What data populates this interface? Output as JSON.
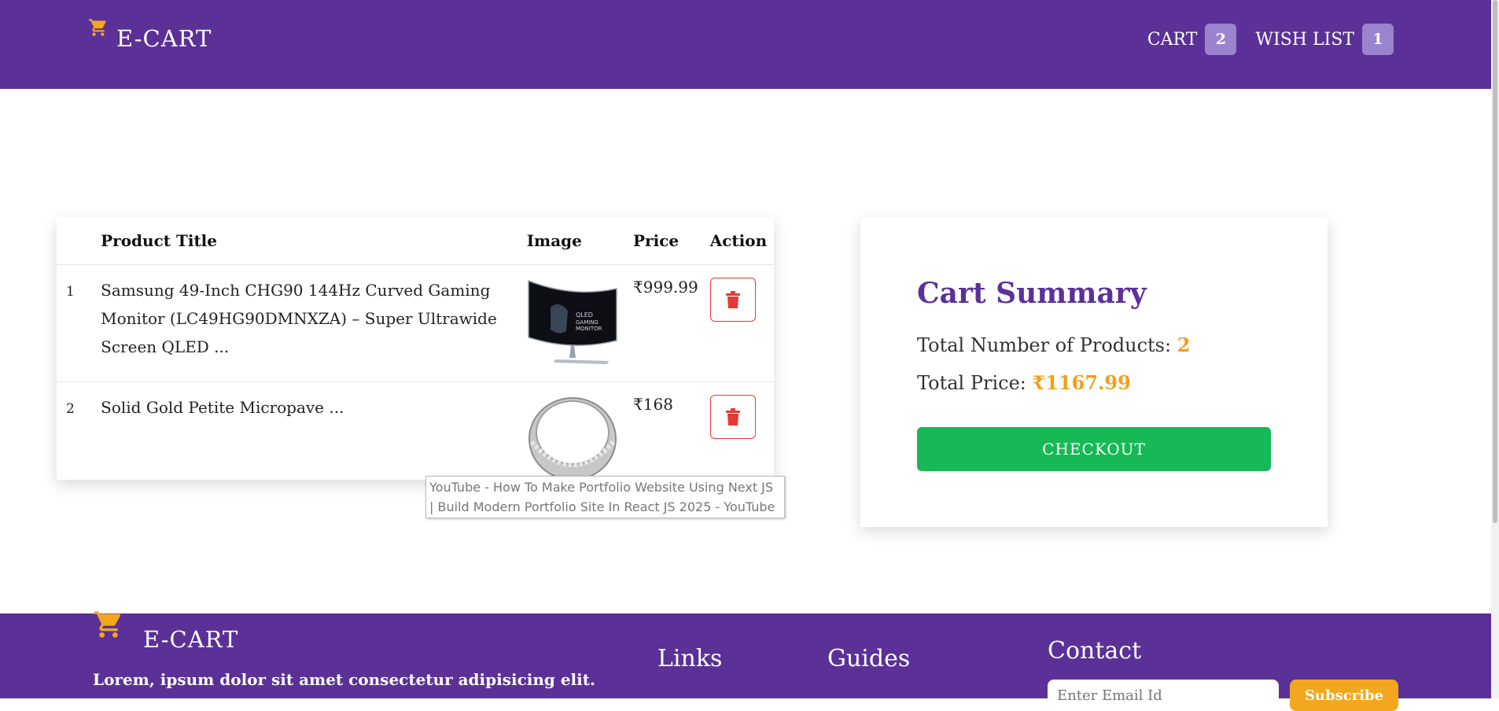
{
  "header": {
    "brand": "E-CART",
    "cart_label": "CART",
    "cart_count": "2",
    "wishlist_label": "WISH LIST",
    "wishlist_count": "1"
  },
  "table": {
    "headers": [
      "",
      "Product Title",
      "Image",
      "Price",
      "Action"
    ],
    "rows": [
      {
        "num": "1",
        "title": "Samsung 49-Inch CHG90 144Hz Curved Gaming Monitor (LC49HG90DMNXZA) – Super Ultrawide Screen QLED ...",
        "image_alt": "curved gaming monitor",
        "price": "₹999.99"
      },
      {
        "num": "2",
        "title": "Solid Gold Petite Micropave ...",
        "image_alt": "silver ring",
        "price": "₹168"
      }
    ]
  },
  "tooltip": {
    "text": "YouTube - How To Make Portfolio Website Using Next JS | Build Modern Portfolio Site In React JS 2025 - YouTube"
  },
  "summary": {
    "title": "Cart Summary",
    "products_label": "Total Number of Products:",
    "products_value": "2",
    "price_label": "Total Price:",
    "price_value": "₹1167.99",
    "checkout_label": "CHECKOUT"
  },
  "footer": {
    "brand": "E-CART",
    "description": "Lorem, ipsum dolor sit amet consectetur adipisicing elit.",
    "links_heading": "Links",
    "guides_heading": "Guides",
    "contact_heading": "Contact",
    "email_placeholder": "Enter Email Id",
    "subscribe_label": "Subscribe"
  },
  "colors": {
    "brand_purple": "#5b3197",
    "accent_orange": "#f0a01c",
    "checkout_green": "#16b955",
    "delete_red": "#e53935",
    "badge_lavender": "#9b83cf"
  },
  "icons": [
    "cart-icon",
    "trash-icon"
  ]
}
